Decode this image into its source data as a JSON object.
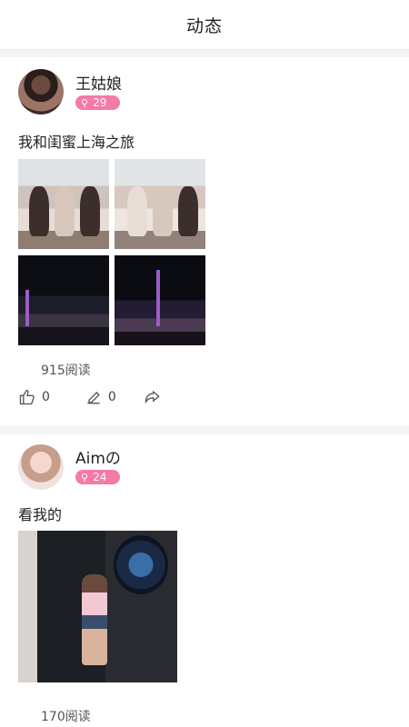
{
  "header": {
    "title": "动态"
  },
  "posts": [
    {
      "username": "王姑娘",
      "badge": "29",
      "caption": "我和闺蜜上海之旅",
      "reads": "915阅读",
      "likes": "0",
      "comments": "0"
    },
    {
      "username": "Aimの",
      "badge": "24",
      "caption": "看我的",
      "reads": "170阅读"
    }
  ],
  "colors": {
    "badge": "#f47aa8",
    "background": "#f4f4f4"
  },
  "icons": {
    "like": "thumbs-up-icon",
    "comment": "pencil-icon",
    "share": "share-icon",
    "badge": "search-icon"
  }
}
